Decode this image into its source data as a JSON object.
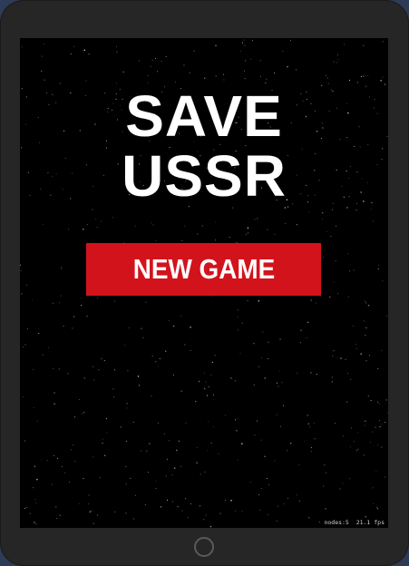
{
  "game": {
    "title_line_1": "SAVE",
    "title_line_2": "USSR",
    "new_game_label": "NEW GAME",
    "stats": {
      "nodes": "nodes:5",
      "fps": "21.1 fps"
    }
  },
  "colors": {
    "button_red": "#d3131c",
    "background": "#000000",
    "device_frame": "#262626",
    "text": "#ffffff"
  }
}
